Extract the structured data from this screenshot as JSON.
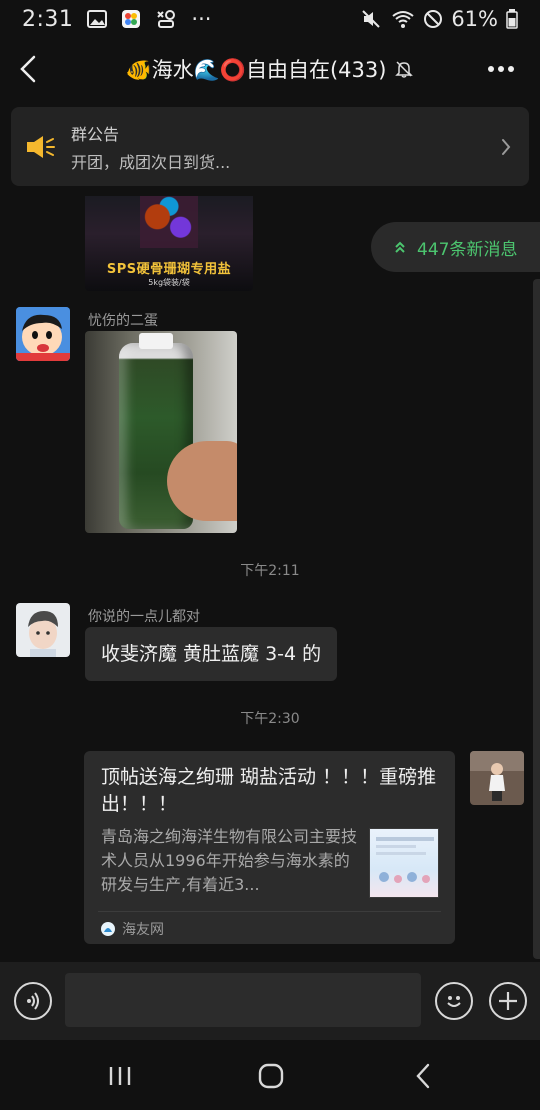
{
  "status_bar": {
    "time": "2:31",
    "more_indicator": "···",
    "battery_percent": "61%"
  },
  "header": {
    "title": "🐠海水🌊⭕自由自在(433)"
  },
  "announcement": {
    "title": "群公告",
    "body": "开团，成团次日到货..."
  },
  "new_messages": {
    "label": "447条新消息"
  },
  "messages": [
    {
      "type": "image",
      "caption": "SPS硬骨珊瑚专用盐",
      "subcaption": "5kg袋装/袋"
    },
    {
      "type": "image",
      "sender": "忧伤的二蛋"
    },
    {
      "type": "timestamp",
      "time": "下午2:11"
    },
    {
      "type": "text",
      "sender": "你说的一点儿都对",
      "text": "收斐济魔 黄肚蓝魔 3-4 的"
    },
    {
      "type": "timestamp",
      "time": "下午2:30"
    },
    {
      "type": "link_card",
      "title": "顶帖送海之绚珊 瑚盐活动 ！！！重磅推出！！！",
      "description": "青岛海之绚海洋生物有限公司主要技术人员从1996年开始参与海水素的研发与生产,有着近3...",
      "source": "海友网"
    }
  ],
  "input": {
    "placeholder": ""
  },
  "colors": {
    "background": "#111111",
    "bubble": "#2c2c2c",
    "accent_green": "#4cc56f",
    "announce_yellow": "#f5b82e"
  },
  "icons": {
    "back": "chevron-left-icon",
    "more": "more-dots-icon",
    "mute": "bell-off-icon",
    "announce": "speaker-icon",
    "voice": "voice-icon",
    "emoji": "emoji-icon",
    "plus": "plus-icon"
  }
}
